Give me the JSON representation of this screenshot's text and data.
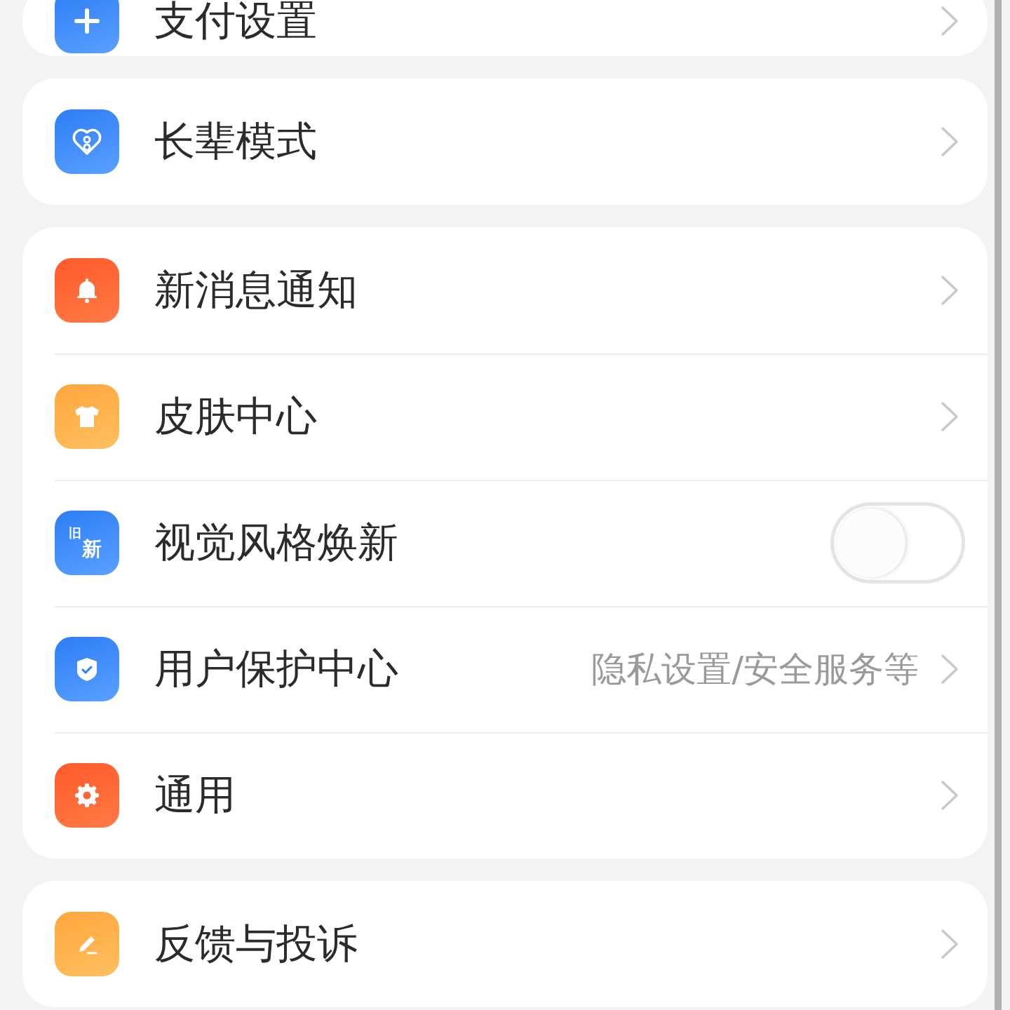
{
  "sections": [
    {
      "items": [
        {
          "kind": "link",
          "label": "支付设置"
        }
      ]
    },
    {
      "items": [
        {
          "kind": "link",
          "label": "长辈模式"
        }
      ]
    },
    {
      "items": [
        {
          "kind": "link",
          "label": "新消息通知"
        },
        {
          "kind": "link",
          "label": "皮肤中心"
        },
        {
          "kind": "toggle",
          "label": "视觉风格焕新",
          "icon_labels": [
            "旧",
            "新"
          ],
          "on": false
        },
        {
          "kind": "link",
          "label": "用户保护中心",
          "value": "隐私设置/安全服务等"
        },
        {
          "kind": "link",
          "label": "通用"
        }
      ]
    },
    {
      "items": [
        {
          "kind": "link",
          "label": "反馈与投诉"
        }
      ]
    }
  ]
}
